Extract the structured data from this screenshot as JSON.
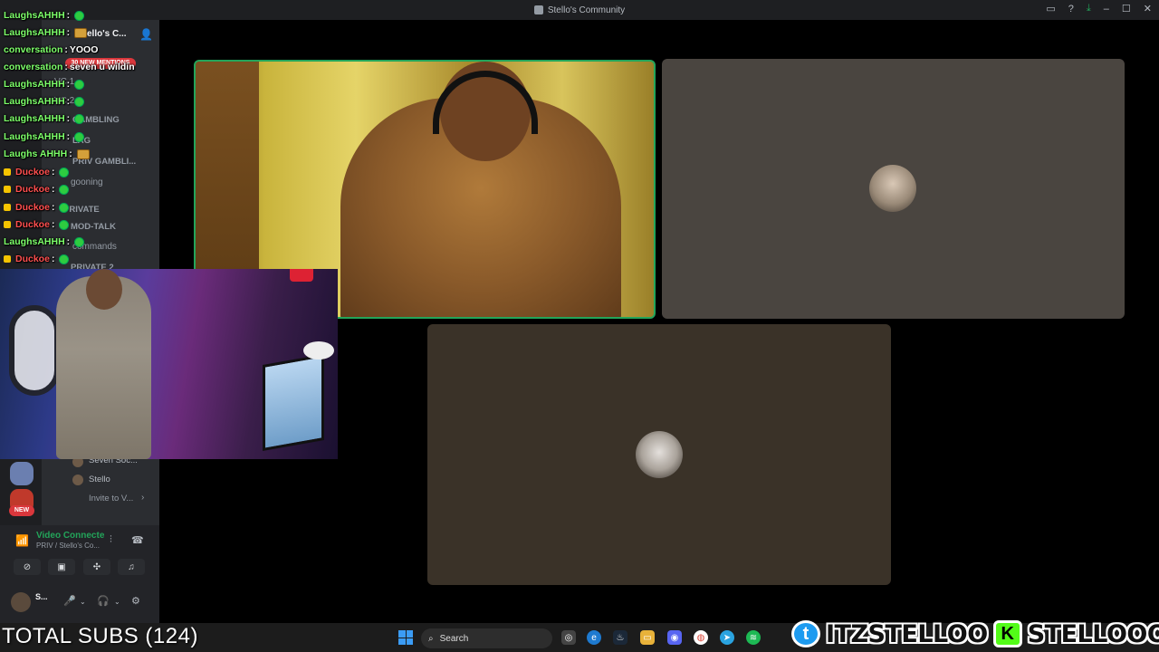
{
  "window": {
    "title": "Stello's Community"
  },
  "server": {
    "name": "Stello's C...",
    "mentions_badge": "30 NEW MENTIONS"
  },
  "channels": [
    {
      "label": "VC 1"
    },
    {
      "label": "VC 2"
    },
    {
      "label": "GAMBLING"
    },
    {
      "label": "LAG"
    },
    {
      "label": "PRIV GAMBLI..."
    },
    {
      "label": "gooning"
    },
    {
      "label": "PRIVATE"
    },
    {
      "label": "MOD-TALK"
    },
    {
      "label": "commands"
    },
    {
      "label": "PRIVATE 2"
    }
  ],
  "voice_users": [
    {
      "name": "Seven Soc..."
    },
    {
      "name": "Stello"
    }
  ],
  "invite_label": "Invite to V...",
  "new_badge": "NEW",
  "voice_panel": {
    "status": "Video Connecte",
    "location": "PRIV / Stello's Co..."
  },
  "user_bar": {
    "name": "S..."
  },
  "chat": [
    {
      "user": "LaughsAHHH",
      "sep": " :",
      "text": "",
      "color": "#7dff6a"
    },
    {
      "user": "LaughsAHHH",
      "sep": " :",
      "text": "",
      "color": "#7dff6a"
    },
    {
      "user": "conversation",
      "sep": " :",
      "text": " YOOO",
      "color": "#7dff6a"
    },
    {
      "user": "conversation",
      "sep": " :",
      "text": " seven u wildin",
      "color": "#7dff6a"
    },
    {
      "user": "LaughsAHHH",
      "sep": " :",
      "text": "",
      "color": "#7dff6a"
    },
    {
      "user": "LaughsAHHH",
      "sep": " :",
      "text": "",
      "color": "#7dff6a"
    },
    {
      "user": "LaughsAHHH",
      "sep": " :",
      "text": "",
      "color": "#7dff6a"
    },
    {
      "user": "LaughsAHHH",
      "sep": " :",
      "text": "",
      "color": "#7dff6a"
    },
    {
      "user": "Laughs AHHH",
      "sep": " :",
      "text": "",
      "color": "#7dff6a"
    },
    {
      "user": "Duckoe",
      "sep": " :",
      "text": "",
      "color": "#ff4f4f"
    },
    {
      "user": "Duckoe",
      "sep": " :",
      "text": "",
      "color": "#ff4f4f"
    },
    {
      "user": "Duckoe",
      "sep": " :",
      "text": "",
      "color": "#ff4f4f"
    },
    {
      "user": "Duckoe",
      "sep": " :",
      "text": "",
      "color": "#ff4f4f"
    },
    {
      "user": "LaughsAHHH",
      "sep": " :",
      "text": "",
      "color": "#7dff6a"
    },
    {
      "user": "Duckoe",
      "sep": " :",
      "text": "",
      "color": "#ff4f4f"
    }
  ],
  "overlay": {
    "total_subs": "TOTAL SUBS (124)",
    "twitter_handle": "ITZSTELLOO",
    "kick_handle": "STELLOOO"
  },
  "taskbar": {
    "search_placeholder": "Search"
  },
  "colors": {
    "speaking": "#23a55a",
    "discord_bg": "#2b2d31",
    "danger": "#da373c"
  }
}
